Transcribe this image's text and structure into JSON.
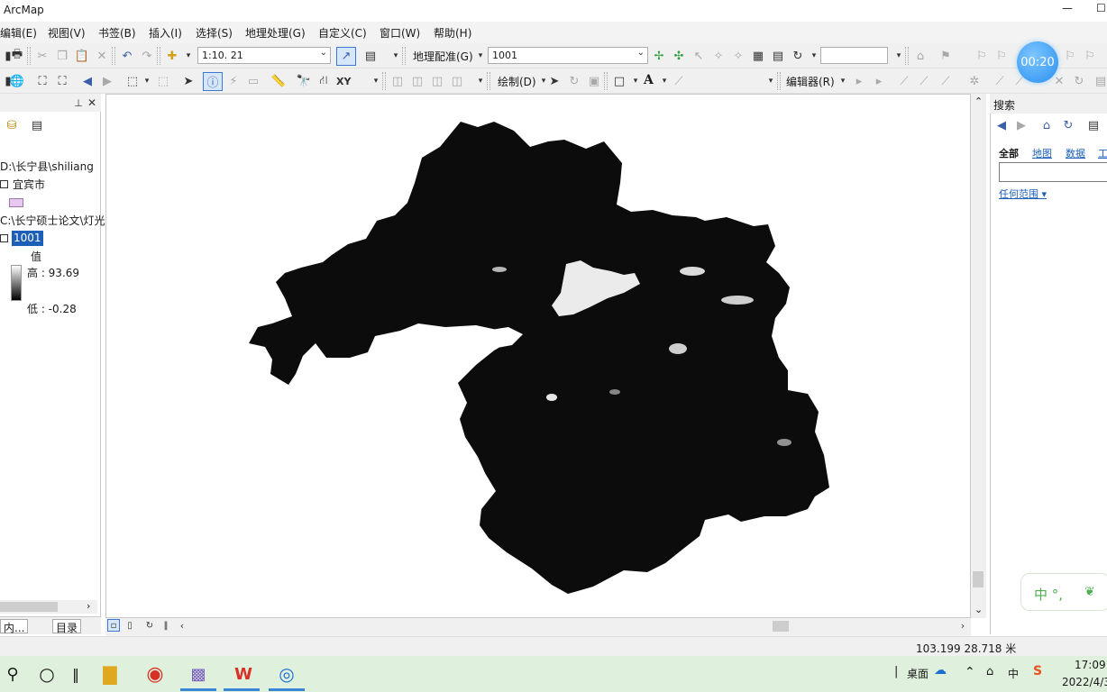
{
  "window": {
    "title": "ArcMap",
    "min_glyph": "—",
    "max_glyph": "☐"
  },
  "menus": [
    "编辑(E)",
    "视图(V)",
    "书签(B)",
    "插入(I)",
    "选择(S)",
    "地理处理(G)",
    "自定义(C)",
    "窗口(W)",
    "帮助(H)"
  ],
  "toolbar1": {
    "scale": "1:10. 21",
    "georef_label": "地理配准(G)",
    "layer_value": "1001",
    "extra_input": ""
  },
  "toolbar2": {
    "draw_label": "绘制(D)",
    "editor_label": "编辑器(R)",
    "font_glyph": "A",
    "xy_label": "XY"
  },
  "toc": {
    "path1": "D:\\长宁县\\shiliang",
    "layer1": "宜宾市",
    "path2": "C:\\长宁硕士论文\\灯光",
    "layer_selected": "1001",
    "value_label": "值",
    "high": "高 : 93.69",
    "low": "低 : -0.28",
    "tab_contents": "内...",
    "tab_catalog": "目录"
  },
  "search": {
    "title": "搜索",
    "tabs": [
      "全部",
      "地图",
      "数据",
      "工"
    ],
    "input_value": "",
    "scope": "任何范围"
  },
  "map": {
    "background": "#ffffff",
    "raster_fill": "#0c0c0c"
  },
  "status": {
    "coords": "103.199  28.718 米"
  },
  "taskbar": {
    "desktop_label": "桌面",
    "ime_label": "中",
    "time": "17:09",
    "date": "2022/4/3"
  },
  "overlay": {
    "timer": "00:20",
    "ime_bar": "中 °,"
  },
  "colors": {
    "accent": "#1c5fb8",
    "taskbar": "#dff0dc",
    "timer": "#2a8ff0"
  }
}
